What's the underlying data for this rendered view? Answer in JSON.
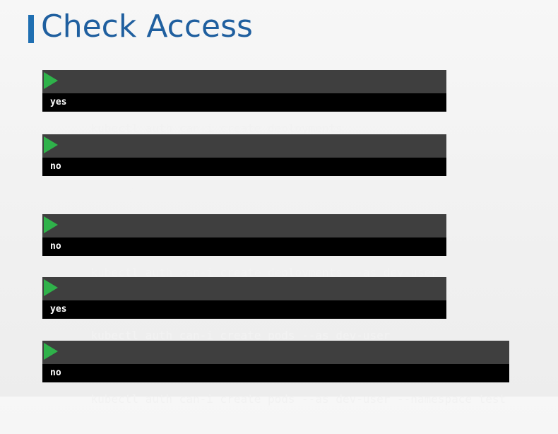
{
  "slide": {
    "title": "Check Access"
  },
  "commands": [
    {
      "command": "kubectl auth can-i create deployments",
      "output": "yes"
    },
    {
      "command": "kubectl auth can-i delete nodes",
      "output": "no"
    },
    {
      "command": "kubectl auth can-i create deployments --as dev-user",
      "output": "no"
    },
    {
      "command": "kubectl auth can-i create pods --as dev-user",
      "output": "yes"
    },
    {
      "command": "kubectl auth can-i create pods --as dev-user --namespace test",
      "output": "no"
    }
  ],
  "icons": {
    "prompt": "play-icon"
  },
  "colors": {
    "title": "#1f5f9f",
    "title_bar": "#1f6fb2",
    "command_bg": "#3f3f3f",
    "output_bg": "#000000",
    "prompt_icon": "#2fb24a"
  }
}
